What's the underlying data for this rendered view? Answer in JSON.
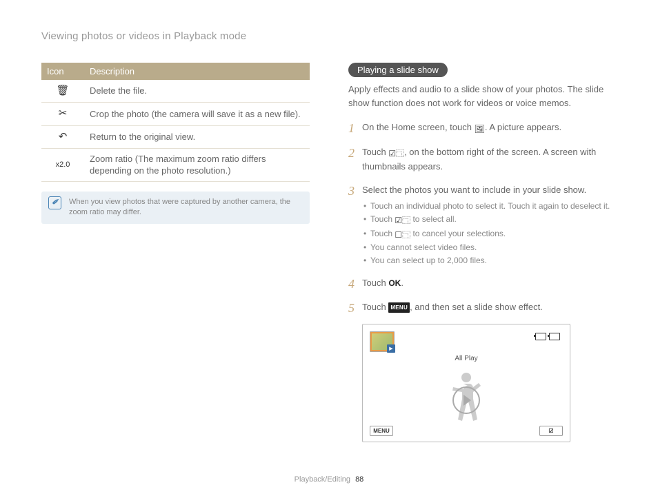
{
  "breadcrumb": "Viewing photos or videos in Playback mode",
  "table": {
    "headers": [
      "Icon",
      "Description"
    ],
    "rows": [
      {
        "icon": "trash-icon",
        "glyph": "🗑",
        "desc": "Delete the file."
      },
      {
        "icon": "scissors-icon",
        "glyph": "✂",
        "desc": "Crop the photo (the camera will save it as a new file)."
      },
      {
        "icon": "return-icon",
        "glyph": "↶",
        "desc": "Return to the original view."
      },
      {
        "icon": "zoom-ratio-icon",
        "glyph": "x2.0",
        "desc": "Zoom ratio (The maximum zoom ratio differs depending on the photo resolution.)"
      }
    ]
  },
  "note": "When you view photos that were captured by another camera, the zoom ratio may differ.",
  "section_title": "Playing a slide show",
  "intro": "Apply effects and audio to a slide show of your photos. The slide show function does not work for videos or voice memos.",
  "steps": [
    {
      "pre": "On the Home screen, touch ",
      "icon": "gallery-icon",
      "post": ". A picture appears."
    },
    {
      "pre": "Touch ",
      "icon": "select-icon",
      "post": ", on the bottom right of the screen. A screen with thumbnails appears."
    },
    {
      "pre": "Select the photos you want to include in your slide show.",
      "sub": [
        "Touch an individual photo to select it. Touch it again to deselect it.",
        {
          "pre": "Touch ",
          "icon": "select-all-icon",
          "post": " to select all."
        },
        {
          "pre": "Touch ",
          "icon": "deselect-icon",
          "post": " to cancel your selections."
        },
        "You cannot select video files.",
        "You can select up to 2,000 files."
      ]
    },
    {
      "pre": "Touch ",
      "icon": "ok-icon",
      "post": "."
    },
    {
      "pre": "Touch ",
      "icon": "menu-icon",
      "post": ", and then set a slide show effect."
    }
  ],
  "screen": {
    "all_play": "All Play",
    "menu": "MENU",
    "select": "☑"
  },
  "footer": {
    "section": "Playback/Editing",
    "page": "88"
  }
}
